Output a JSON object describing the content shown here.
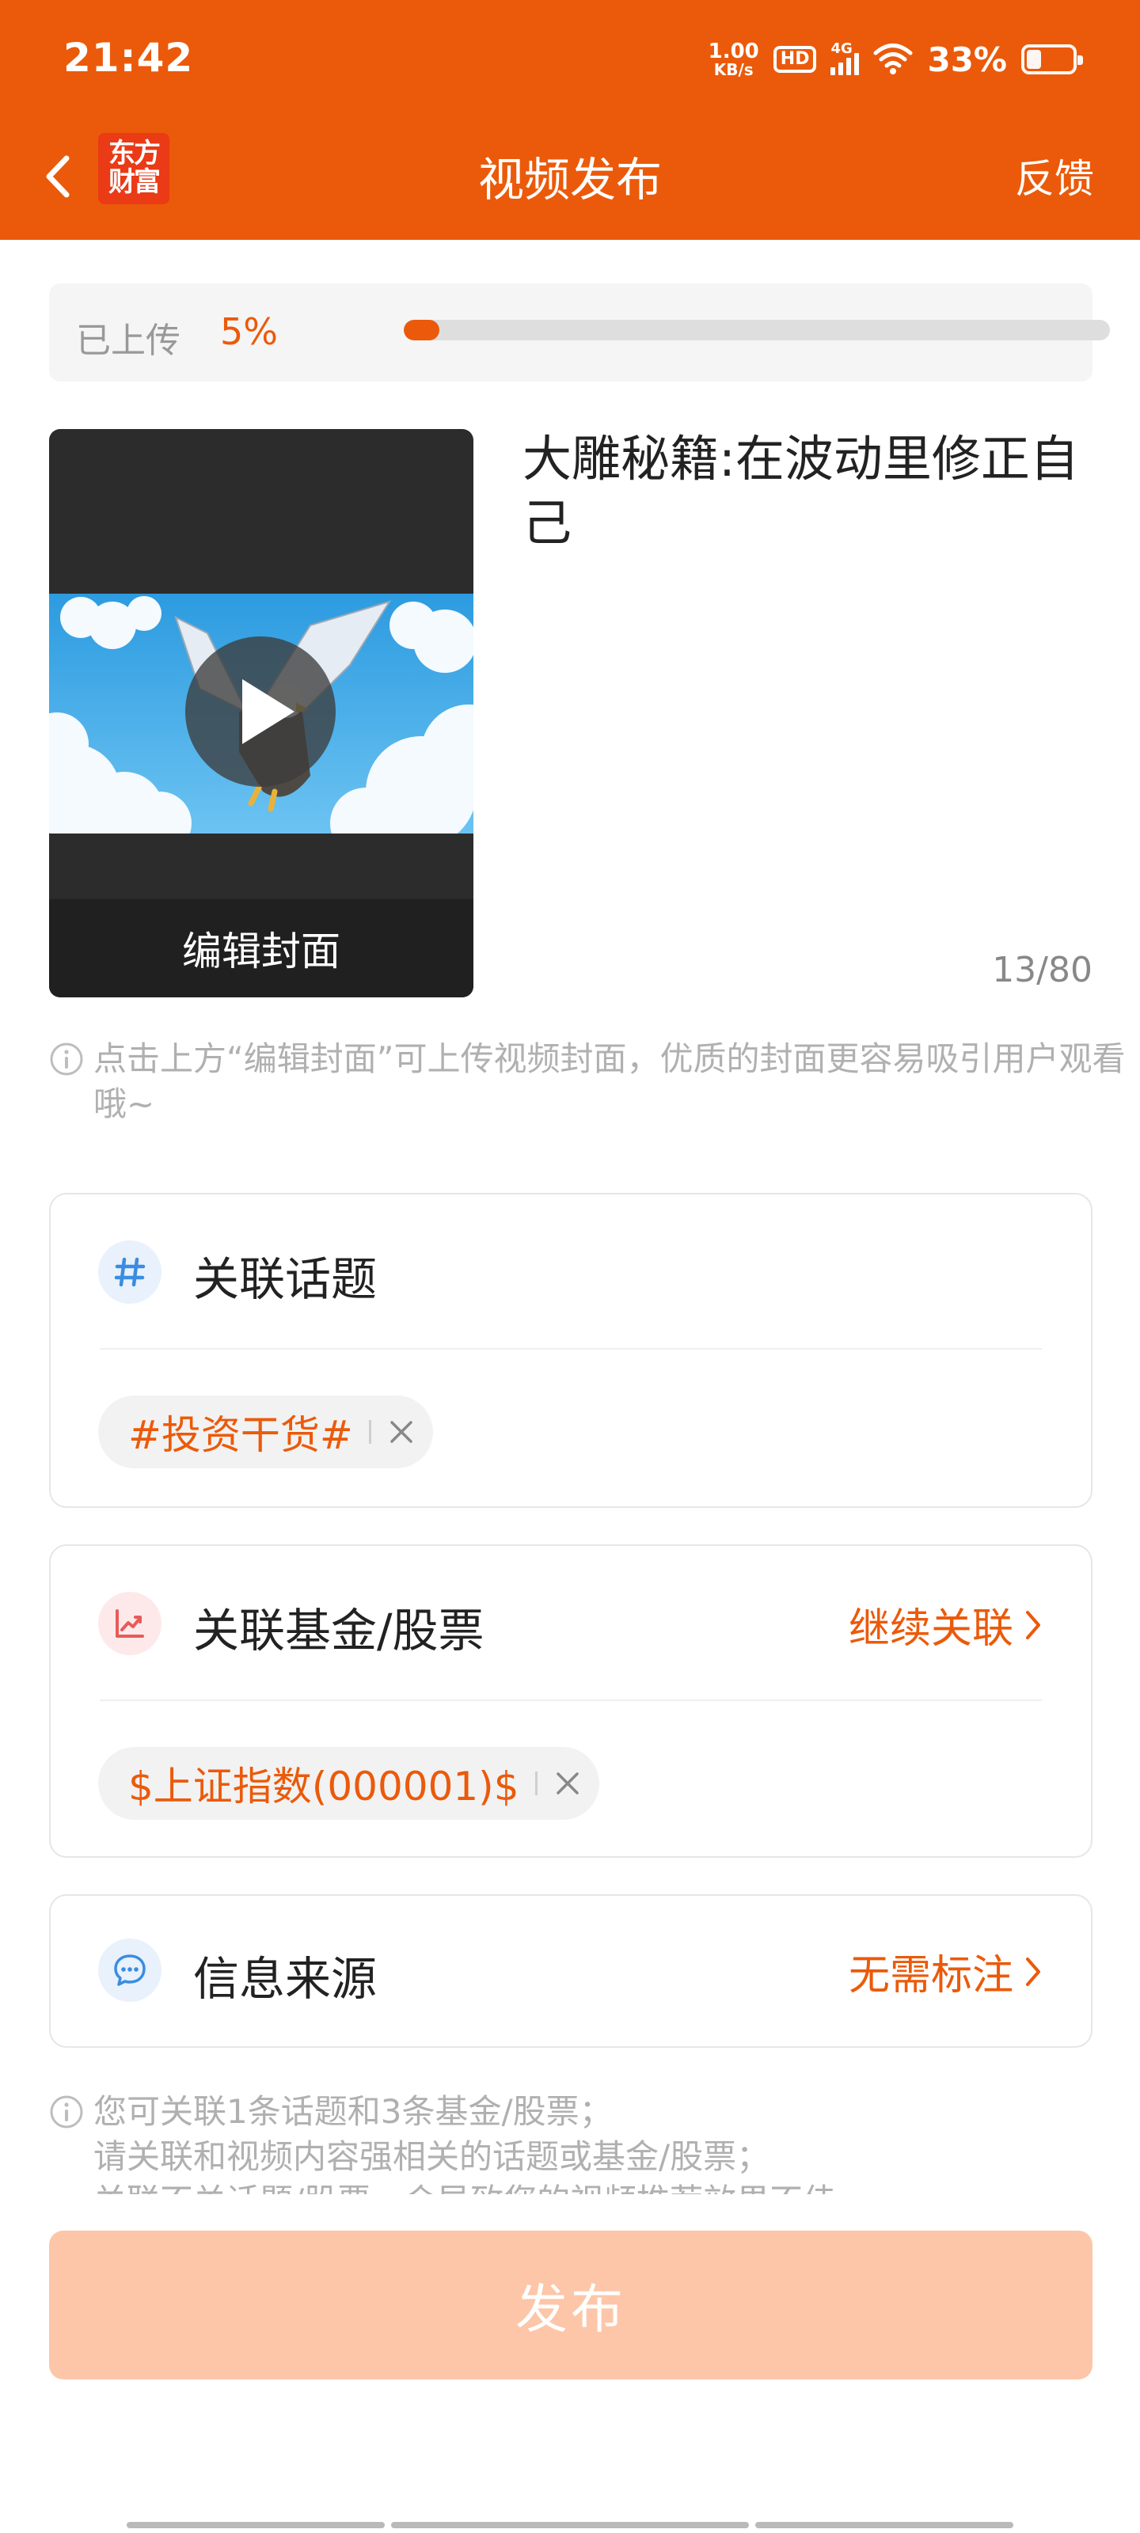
{
  "status_bar": {
    "time": "21:42",
    "net_speed_value": "1.00",
    "net_speed_unit": "KB/s",
    "hd": "HD",
    "network": "4G",
    "battery": "33%",
    "battery_level": 0.33
  },
  "header": {
    "logo_line1": "东方",
    "logo_line2": "财富",
    "title": "视频发布",
    "feedback_label": "反馈"
  },
  "upload": {
    "label": "已上传",
    "percent_text": "5%",
    "progress": 0.05
  },
  "video": {
    "edit_cover_label": "编辑封面",
    "title": "大雕秘籍:在波动里修正自己",
    "char_count": "13/80"
  },
  "cover_hint": "点击上方“编辑封面”可上传视频封面，优质的封面更容易吸引用户观看哦~",
  "topic_card": {
    "title": "关联话题",
    "tag": "#投资干货#"
  },
  "stock_card": {
    "title": "关联基金/股票",
    "action": "继续关联",
    "tag": "$上证指数(000001)$"
  },
  "source_card": {
    "title": "信息来源",
    "action": "无需标注"
  },
  "bottom_hint": {
    "line1": "您可关联1条话题和3条基金/股票；",
    "line2": "请关联和视频内容强相关的话题或基金/股票；",
    "line3": "关联不关话题/股票，会导致您的视频推荐效果不佳"
  },
  "publish_label": "发布",
  "colors": {
    "brand": "#EB5A0A",
    "publish_disabled": "#FDC6A8"
  }
}
